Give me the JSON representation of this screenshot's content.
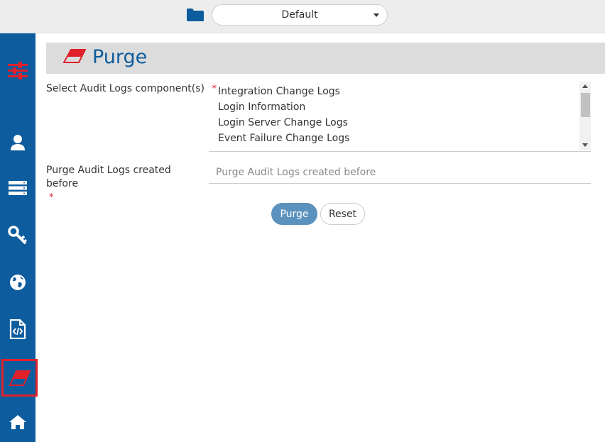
{
  "topbar": {
    "environment": "Default",
    "folder_icon": "folder-icon",
    "dropdown_icon": "chevron-down-icon"
  },
  "sidebar": {
    "items": [
      {
        "name": "settings",
        "icon": "sliders-icon"
      },
      {
        "name": "users",
        "icon": "user-icon"
      },
      {
        "name": "servers",
        "icon": "server-icon"
      },
      {
        "name": "keys",
        "icon": "key-icon"
      },
      {
        "name": "globe",
        "icon": "globe-icon"
      },
      {
        "name": "code-file",
        "icon": "code-file-icon"
      },
      {
        "name": "purge",
        "icon": "eraser-icon",
        "active": true
      },
      {
        "name": "home",
        "icon": "home-icon"
      }
    ]
  },
  "page": {
    "title": "Purge",
    "title_icon": "eraser-icon"
  },
  "form": {
    "components_label": "Select Audit Logs component(s)",
    "required_mark": "*",
    "components_options": [
      "Integration Change Logs",
      "Login Information",
      "Login Server Change Logs",
      "Event Failure Change Logs"
    ],
    "date_label": "Purge Audit Logs created before",
    "date_placeholder": "Purge Audit Logs created before",
    "purge_button": "Purge",
    "reset_button": "Reset"
  },
  "colors": {
    "sidebar": "#0d5c9d",
    "accent_red": "#e0202b",
    "primary_button": "#5b92bd",
    "title_bar": "#dcdcdc"
  }
}
